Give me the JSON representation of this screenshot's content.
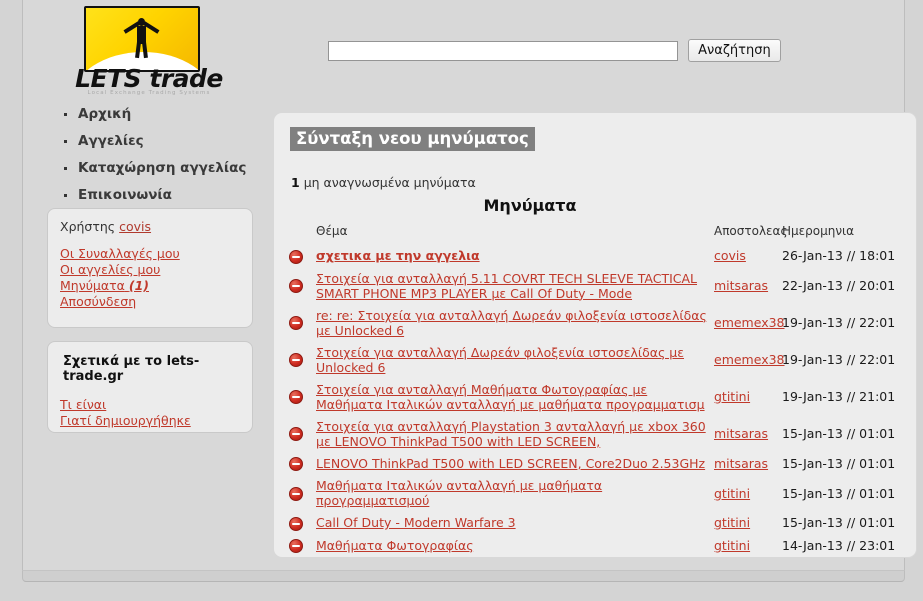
{
  "logo": {
    "word_lets": "LETS",
    "word_trade": "trade",
    "subtitle": "Local Exchange Trading Systems"
  },
  "search": {
    "value": "",
    "placeholder": "",
    "button_label": "Αναζήτηση"
  },
  "nav": {
    "items": [
      {
        "label": "Αρχική"
      },
      {
        "label": "Αγγελίες"
      },
      {
        "label": "Καταχώρηση αγγελίας"
      },
      {
        "label": "Επικοινωνία"
      }
    ]
  },
  "user_box": {
    "user_prefix": "Χρήστης",
    "username": "covis",
    "links": [
      {
        "label": "Οι Συναλλαγές μου",
        "count": ""
      },
      {
        "label": "Οι αγγελίες μου",
        "count": ""
      },
      {
        "label": "Μηνύματα",
        "count": "(1)"
      },
      {
        "label": "Αποσύνδεση",
        "count": ""
      }
    ]
  },
  "about_box": {
    "title": "Σχετικά με το lets-trade.gr",
    "links": [
      {
        "label": "Τι είναι"
      },
      {
        "label": "Γιατί δημιουργήθηκε"
      }
    ]
  },
  "content": {
    "page_title": "Σύνταξη νεου μηνύματος",
    "unread_count": "1",
    "unread_text": "μη αναγνωσμένα μηνύματα",
    "messages_heading": "Μηνύματα",
    "columns": {
      "subject": "Θέμα",
      "sender": "Αποστολεας",
      "date": "Ημερομηνια"
    },
    "rows": [
      {
        "subject": "σχετικα με την αγγελια",
        "sender": "covis",
        "date": "26-Jan-13 // 18:01",
        "unread": true,
        "icon": "delete-icon"
      },
      {
        "subject": "Στοιχεία για ανταλλαγή 5.11 COVRT TECH SLEEVE TACTICAL SMART PHONE MP3 PLAYER με Call Of Duty - Mode",
        "sender": "mitsaras",
        "date": "22-Jan-13 // 20:01",
        "unread": false,
        "icon": "delete-icon"
      },
      {
        "subject": "re: re: Στοιχεία για ανταλλαγή Δωρεάν φιλοξενία ιστοσελίδας με Unlocked 6",
        "sender": "ememex38",
        "date": "19-Jan-13 // 22:01",
        "unread": false,
        "icon": "delete-icon"
      },
      {
        "subject": "Στοιχεία για ανταλλαγή Δωρεάν φιλοξενία ιστοσελίδας με Unlocked 6",
        "sender": "ememex38",
        "date": "19-Jan-13 // 22:01",
        "unread": false,
        "icon": "delete-icon"
      },
      {
        "subject": "Στοιχεία για ανταλλαγή Μαθήματα Φωτογραφίας με Μαθήματα Ιταλικών ανταλλαγή με μαθήματα προγραμματισμ",
        "sender": "gtitini",
        "date": "19-Jan-13 // 21:01",
        "unread": false,
        "icon": "delete-icon"
      },
      {
        "subject": "Στοιχεία για ανταλλαγή Playstation 3 ανταλλαγή με xbox 360 με LENOVO ThinkPad T500 with LED SCREEN,",
        "sender": "mitsaras",
        "date": "15-Jan-13 // 01:01",
        "unread": false,
        "icon": "delete-icon"
      },
      {
        "subject": "LENOVO ThinkPad T500 with LED SCREEN, Core2Duo 2.53GHz",
        "sender": "mitsaras",
        "date": "15-Jan-13 // 01:01",
        "unread": false,
        "icon": "delete-icon"
      },
      {
        "subject": "Μαθήματα Ιταλικών ανταλλαγή με μαθήματα προγραμματισμού",
        "sender": "gtitini",
        "date": "15-Jan-13 // 01:01",
        "unread": false,
        "icon": "delete-icon"
      },
      {
        "subject": "Call Of Duty - Modern Warfare 3",
        "sender": "gtitini",
        "date": "15-Jan-13 // 01:01",
        "unread": false,
        "icon": "delete-icon"
      },
      {
        "subject": "Μαθήματα Φωτογραφίας",
        "sender": "gtitini",
        "date": "14-Jan-13 // 23:01",
        "unread": false,
        "icon": "delete-icon"
      }
    ]
  },
  "colors": {
    "link_red": "#c0392b",
    "title_bg": "#808080",
    "page_bg": "#d4d4d4",
    "panel_bg": "#ededed",
    "logo_yellow": "#ffd400"
  }
}
